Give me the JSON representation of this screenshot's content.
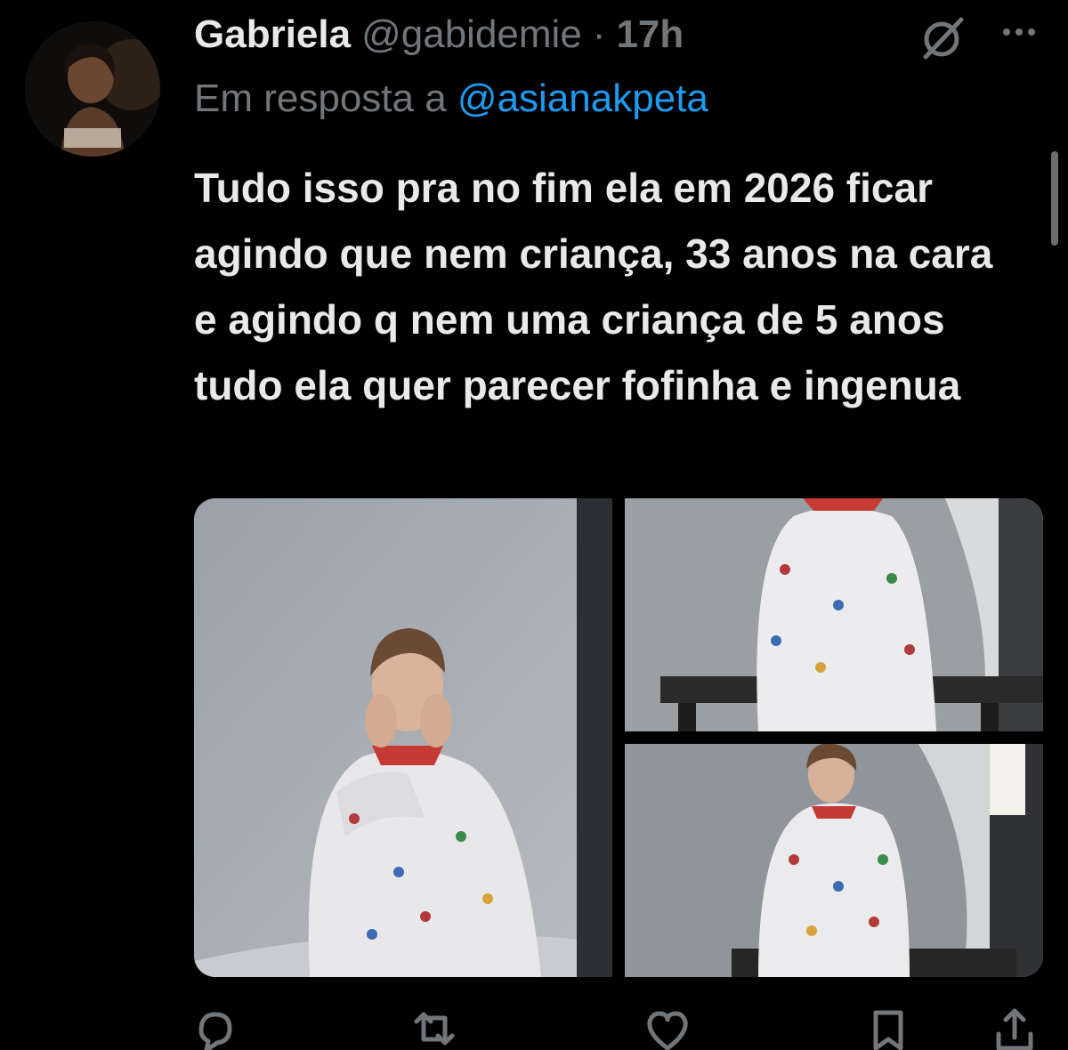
{
  "tweet": {
    "author_name": "Gabriela",
    "author_handle": "@gabidemie",
    "separator": "·",
    "time": "17h",
    "reply_prefix": "Em resposta a",
    "reply_to": "@asianakpeta",
    "text": "Tudo isso pra no fim ela em 2026 ficar agindo que nem criança, 33 anos na cara e agindo q nem uma criança de 5 anos tudo ela quer parecer fofinha e ingenua"
  },
  "icons": {
    "grok": "grok-icon",
    "more": "more-icon",
    "reply": "reply-icon",
    "retweet": "retweet-icon",
    "like": "heart-icon",
    "bookmark": "bookmark-icon",
    "share": "share-icon"
  },
  "colors": {
    "background": "#000000",
    "text": "#e7e9ea",
    "secondary": "#71767b",
    "link": "#1d9bf0"
  }
}
